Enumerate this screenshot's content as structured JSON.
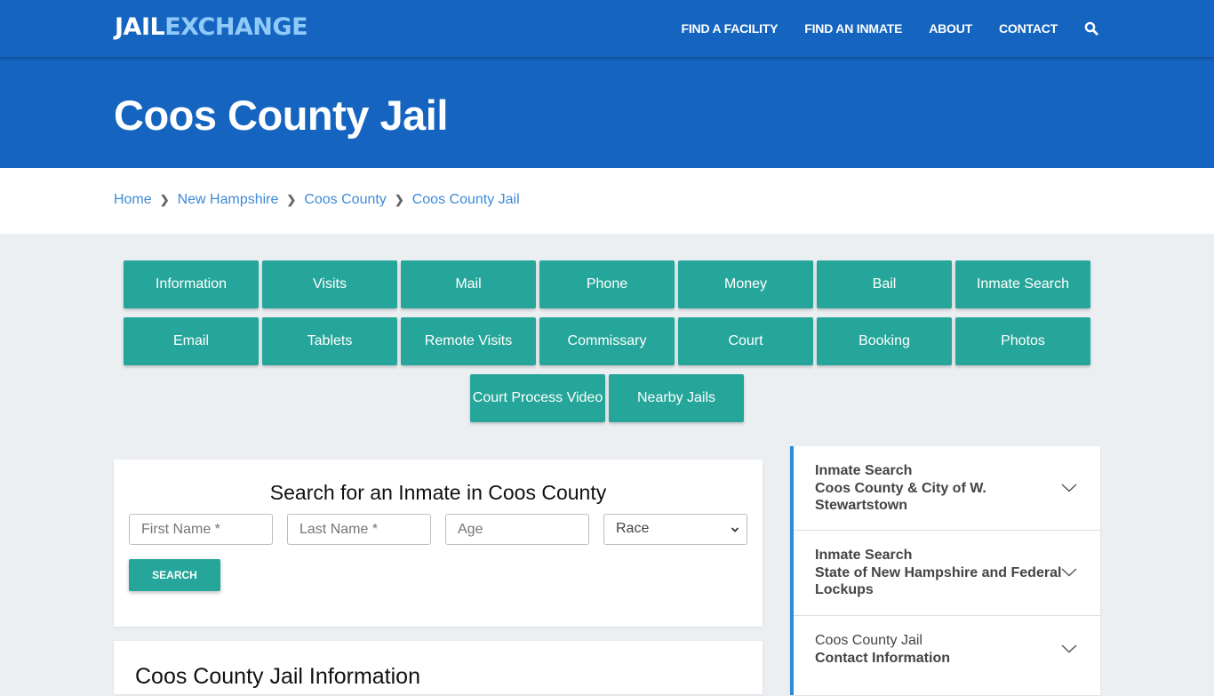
{
  "header": {
    "logo": {
      "part1": "JAIL",
      "part2": "EXCHANGE"
    },
    "nav": [
      {
        "label": "FIND A FACILITY"
      },
      {
        "label": "FIND AN INMATE"
      },
      {
        "label": "ABOUT"
      },
      {
        "label": "CONTACT"
      }
    ],
    "search_icon": "search-icon"
  },
  "hero": {
    "title": "Coos County Jail"
  },
  "breadcrumb": [
    {
      "label": "Home"
    },
    {
      "label": "New Hampshire"
    },
    {
      "label": "Coos County"
    },
    {
      "label": "Coos County Jail"
    }
  ],
  "tabs": {
    "row1": [
      "Information",
      "Visits",
      "Mail",
      "Phone",
      "Money",
      "Bail",
      "Inmate Search"
    ],
    "row2": [
      "Email",
      "Tablets",
      "Remote Visits",
      "Commissary",
      "Court",
      "Booking",
      "Photos"
    ],
    "row3": [
      "Court Process Video",
      "Nearby Jails"
    ]
  },
  "search": {
    "title": "Search for an Inmate in Coos County",
    "first_name_placeholder": "First Name *",
    "last_name_placeholder": "Last Name *",
    "age_placeholder": "Age",
    "race_selected": "Race",
    "button": "SEARCH"
  },
  "info": {
    "title": "Coos County Jail Information"
  },
  "sidebar": [
    {
      "line1": "Inmate Search",
      "line2": "Coos County & City of W.",
      "line3": "Stewartstown"
    },
    {
      "line1": "Inmate Search",
      "line2": "State of New Hampshire and Federal",
      "line3": "Lockups"
    },
    {
      "line1": "Coos County Jail",
      "line2": "Contact Information"
    }
  ],
  "colors": {
    "brand_blue": "#1565c0",
    "logo_accent": "#90caf9",
    "teal": "#26a69a",
    "link": "#3d8bd6",
    "sidebar_accent": "#2d8bd8"
  }
}
